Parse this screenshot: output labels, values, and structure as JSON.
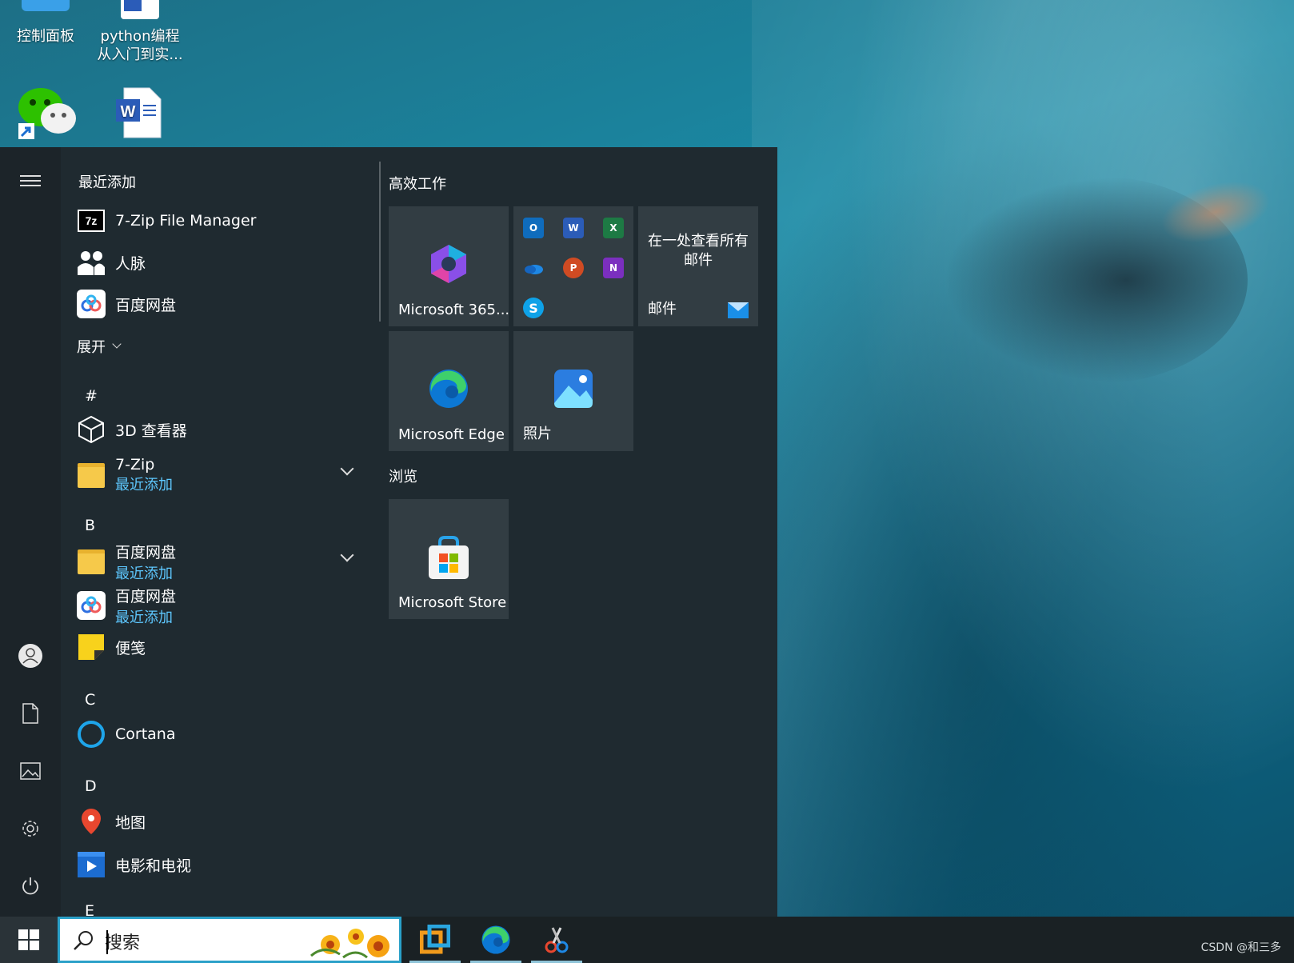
{
  "desktop": {
    "icons": [
      {
        "label": "控制面板"
      },
      {
        "label": "python编程\n从入门到实..."
      },
      {
        "label": ""
      },
      {
        "label": ""
      }
    ]
  },
  "start_menu": {
    "recent_header": "最近添加",
    "recent": [
      {
        "name": "7-Zip File Manager",
        "icon": "7zip-icon"
      },
      {
        "name": "人脉",
        "icon": "people-icon"
      },
      {
        "name": "百度网盘",
        "icon": "baidu-netdisk-icon"
      }
    ],
    "expand_label": "展开",
    "letters": {
      "hash": "#",
      "b": "B",
      "c": "C",
      "d": "D",
      "e": "E"
    },
    "apps": {
      "viewer3d": "3D 查看器",
      "zip7": {
        "name": "7-Zip",
        "sub": "最近添加"
      },
      "baidu_folder": {
        "name": "百度网盘",
        "sub": "最近添加"
      },
      "baidu_app": {
        "name": "百度网盘",
        "sub": "最近添加"
      },
      "sticky": "便笺",
      "cortana": "Cortana",
      "maps": "地图",
      "movies": "电影和电视"
    },
    "groups": {
      "productivity": "高效工作",
      "browse": "浏览"
    },
    "tiles": {
      "m365": "Microsoft 365...",
      "mail_text": "在一处查看所有邮件",
      "mail_label": "邮件",
      "edge": "Microsoft Edge",
      "photos": "照片",
      "store": "Microsoft Store"
    }
  },
  "taskbar": {
    "search_placeholder": "搜索",
    "watermark": "CSDN @和三多"
  },
  "colors": {
    "accent": "#2aa0c8",
    "menu_bg": "#1f2a30",
    "tile_bg": "#323d43",
    "sub_text": "#5ec8ff"
  }
}
